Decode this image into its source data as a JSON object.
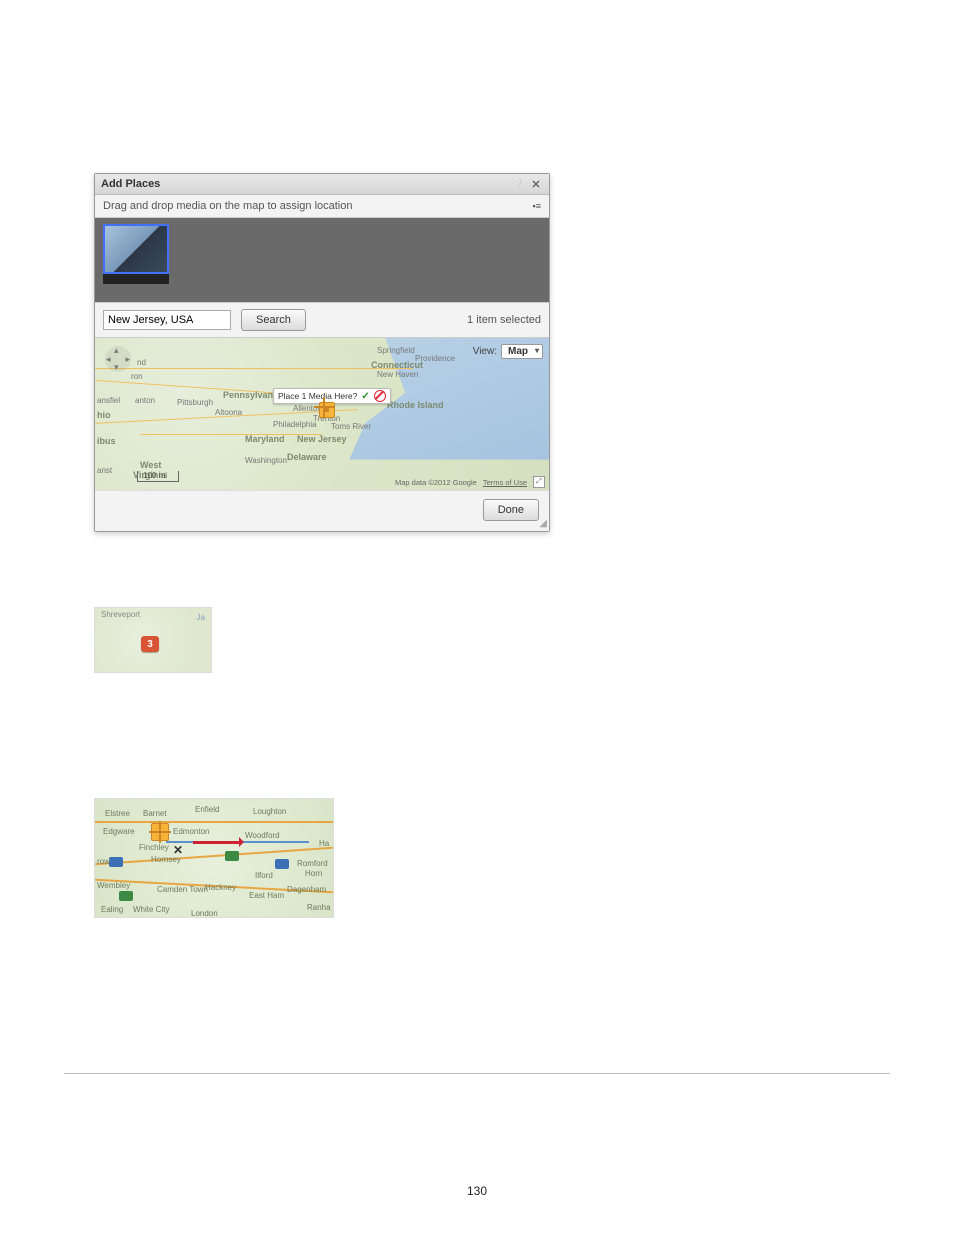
{
  "page_number": "130",
  "dialog": {
    "title": "Add Places",
    "instruction": "Drag and drop media on the map to assign location",
    "search_value": "New Jersey, USA",
    "search_button": "Search",
    "selection_status": "1 item selected",
    "done_button": "Done",
    "view_label": "View:",
    "view_value": "Map",
    "place_popup": "Place 1 Media Here?",
    "scale_label": "100 mi",
    "attribution": "Map data ©2012 Google",
    "terms": "Terms of Use",
    "map_labels": {
      "pennsylvania": "Pennsylvania",
      "connecticut": "Connecticut",
      "rhode_island": "Rhode Island",
      "maryland": "Maryland",
      "new_jersey": "New Jersey",
      "delaware": "Delaware",
      "west_virginia_1": "West",
      "west_virginia_2": "Virginia",
      "hio": "hio",
      "ibus": "ibus",
      "nd": "nd",
      "ron": "ron",
      "anton": "anton",
      "ansfiel": "ansfiel",
      "anst": "anst",
      "springfield": "Springfield",
      "providence": "Providence",
      "new_haven": "New Haven",
      "pittsburgh": "Pittsburgh",
      "altoona": "Altoona",
      "allentown": "Allentown",
      "trenton": "Trenton",
      "philadelphia": "Philadelphia",
      "toms_river": "Toms River",
      "washington": "Washington"
    }
  },
  "mini1": {
    "label_left": "Shreveport",
    "label_right": "Ja",
    "pin_count": "3"
  },
  "mini2": {
    "labels": {
      "elstree": "Elstree",
      "barnet": "Barnet",
      "enfield": "Enfield",
      "loughton": "Loughton",
      "edgware": "Edgware",
      "edmonton": "Edmonton",
      "woodford": "Woodford",
      "finchley": "Finchley",
      "hornsey": "Hornsey",
      "row": "row",
      "ilford": "Ilford",
      "romford": "Romford",
      "horn": "Horn",
      "wembley": "Wembley",
      "camden": "Camden Town",
      "hackney": "Hackney",
      "east_ham": "East Ham",
      "dagenham": "Dagenham",
      "ranha": "Ranha",
      "ealing": "Ealing",
      "white_city": "White City",
      "london": "London",
      "ha": "Ha"
    }
  }
}
